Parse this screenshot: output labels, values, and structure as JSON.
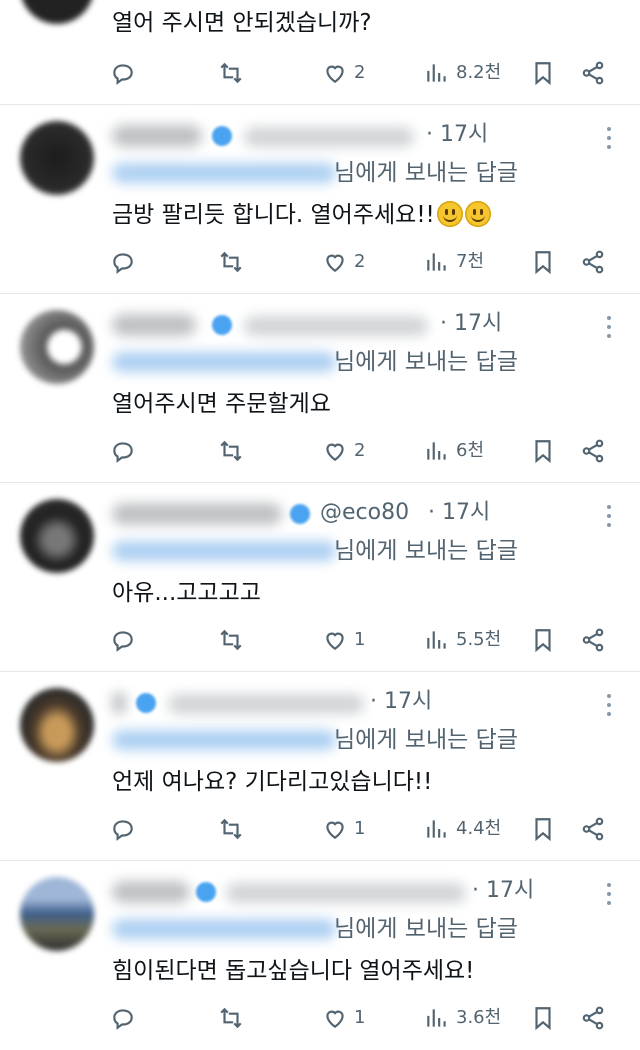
{
  "top_post": {
    "text": "열어 주시면 안되겠습니까?",
    "likes": "2",
    "views": "8.2천"
  },
  "posts": [
    {
      "handle": "",
      "time": "· 17시",
      "reply_to": "님에게 보내는 답글",
      "text": "금방 팔리듯 합니다. 열어주세요!!",
      "emoji_count": 2,
      "likes": "2",
      "views": "7천"
    },
    {
      "handle": "",
      "time": "· 17시",
      "reply_to": "님에게 보내는 답글",
      "text": "열어주시면 주문할게요",
      "likes": "2",
      "views": "6천"
    },
    {
      "handle": "@eco80",
      "time": "· 17시",
      "reply_to": "님에게 보내는 답글",
      "text": "아유...고고고고",
      "likes": "1",
      "views": "5.5천"
    },
    {
      "handle": "",
      "time": "· 17시",
      "reply_to": "님에게 보내는 답글",
      "text": "언제 여나요? 기다리고있습니다!!",
      "likes": "1",
      "views": "4.4천"
    },
    {
      "handle": "",
      "time": "· 17시",
      "reply_to": "님에게 보내는 답글",
      "text": "힘이된다면 돕고싶습니다 열어주세요!",
      "likes": "1",
      "views": "3.6천"
    }
  ],
  "icons": {
    "reply": "reply-icon",
    "repost": "repost-icon",
    "like": "heart-icon",
    "views": "views-icon",
    "bookmark": "bookmark-icon",
    "share": "share-icon",
    "more": "more-icon"
  },
  "colors": {
    "text": "#0f1419",
    "muted": "#536471",
    "verified": "#4aa3f0",
    "divider": "#e6e9ec"
  }
}
